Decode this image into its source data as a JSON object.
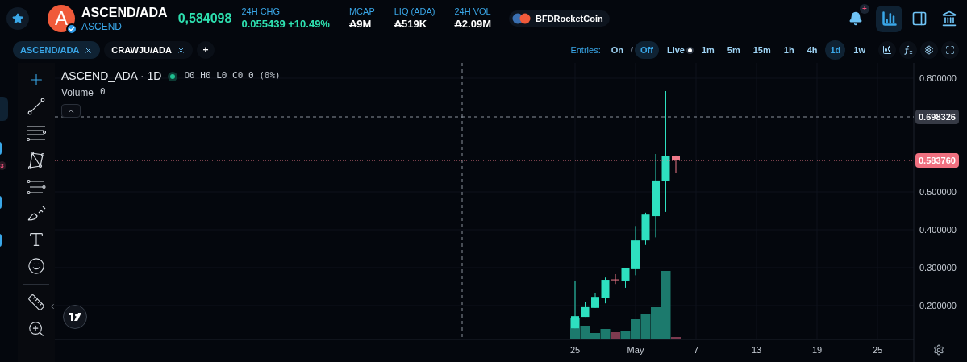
{
  "token": {
    "letter": "A",
    "symbol": "ASCEND/ADA",
    "name": "ASCEND",
    "verified": true
  },
  "price": "0,584098",
  "stats": [
    {
      "label": "24H CHG",
      "value": "0.055439 +10.49%",
      "kind": "change"
    },
    {
      "label": "MCAP",
      "value": "₳9M",
      "kind": "plain"
    },
    {
      "label": "LIQ (ADA)",
      "value": "₳519K",
      "kind": "plain"
    },
    {
      "label": "24H VOL",
      "value": "₳2.09M",
      "kind": "plain"
    }
  ],
  "user": {
    "name": "BFDRocketCoin"
  },
  "notification_badge": "+",
  "header_buttons": [
    {
      "kind": "chart",
      "selected": true
    },
    {
      "kind": "panel",
      "selected": false
    },
    {
      "kind": "bank",
      "selected": false
    }
  ],
  "tabs": [
    {
      "label": "ASCEND/ADA",
      "selected": true
    },
    {
      "label": "CRAWJU/ADA",
      "selected": false
    }
  ],
  "add_tab": "+",
  "entries": {
    "label": "Entries:",
    "separator": "/",
    "options": [
      {
        "label": "On",
        "selected": false
      },
      {
        "label": "Off",
        "selected": true
      }
    ]
  },
  "live": {
    "label": "Live"
  },
  "intervals": [
    {
      "label": "1m",
      "selected": false
    },
    {
      "label": "5m",
      "selected": false
    },
    {
      "label": "15m",
      "selected": false
    },
    {
      "label": "1h",
      "selected": false
    },
    {
      "label": "4h",
      "selected": false
    },
    {
      "label": "1d",
      "selected": true
    },
    {
      "label": "1w",
      "selected": false
    }
  ],
  "sidebar_items": [
    {
      "selected": true
    },
    {
      "selected": false
    },
    {
      "selected": false
    },
    {
      "selected": false
    }
  ],
  "side_badge": "3",
  "chart": {
    "title": "ASCEND_ADA · 1D",
    "ohlc": "O0 H0 L0 C0 0 (0%)",
    "volume_label": "Volume",
    "volume_value": "0",
    "price_ticks": [
      "0.800000",
      "0.500000",
      "0.400000",
      "0.300000",
      "0.200000"
    ],
    "time_ticks": [
      "25",
      "May",
      "7",
      "13",
      "19",
      "25"
    ],
    "crosshair_price": "0.698326",
    "last_price": "0.583760"
  }
}
